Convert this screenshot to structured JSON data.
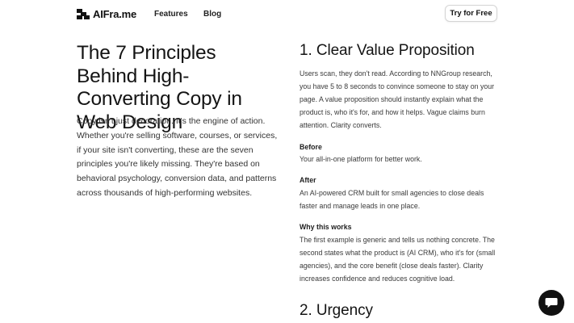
{
  "header": {
    "logo_text": "AIFra.me",
    "nav": {
      "features_label": "Features",
      "blog_label": "Blog"
    },
    "cta_label": "Try for Free"
  },
  "hero": {
    "title": "The 7 Principles Behind High-Converting Copy in Web Design",
    "intro": "Copy isn't just decoration. It's the engine of action. Whether you're selling software, courses, or services, if your site isn't converting, these are the seven principles you're likely missing. They're based on behavioral psychology, conversion data, and patterns across thousands of high-performing websites."
  },
  "sections": {
    "s1": {
      "heading": "1. Clear Value Proposition",
      "body": "Users scan, they don't read. According to NNGroup research, you have 5 to 8 seconds to convince someone to stay on your page. A value proposition should instantly explain what the product is, who it's for, and how it helps. Vague claims burn attention. Clarity converts.",
      "before_label": "Before",
      "before_text": "Your all-in-one platform for better work.",
      "after_label": "After",
      "after_text": "An AI-powered CRM built for small agencies to close deals faster and manage leads in one place.",
      "why_label": "Why this works",
      "why_text": "The first example is generic and tells us nothing concrete. The second states what the product is (AI CRM), who it's for (small agencies), and the core benefit (close deals faster). Clarity increases confidence and reduces cognitive load."
    },
    "s2": {
      "heading": "2. Urgency"
    }
  },
  "chat": {
    "icon": "chat-bubble-icon"
  },
  "colors": {
    "text": "#141414",
    "body_text": "#3a3a3a",
    "chat_bg": "#111111",
    "border": "#d4d4d4"
  }
}
